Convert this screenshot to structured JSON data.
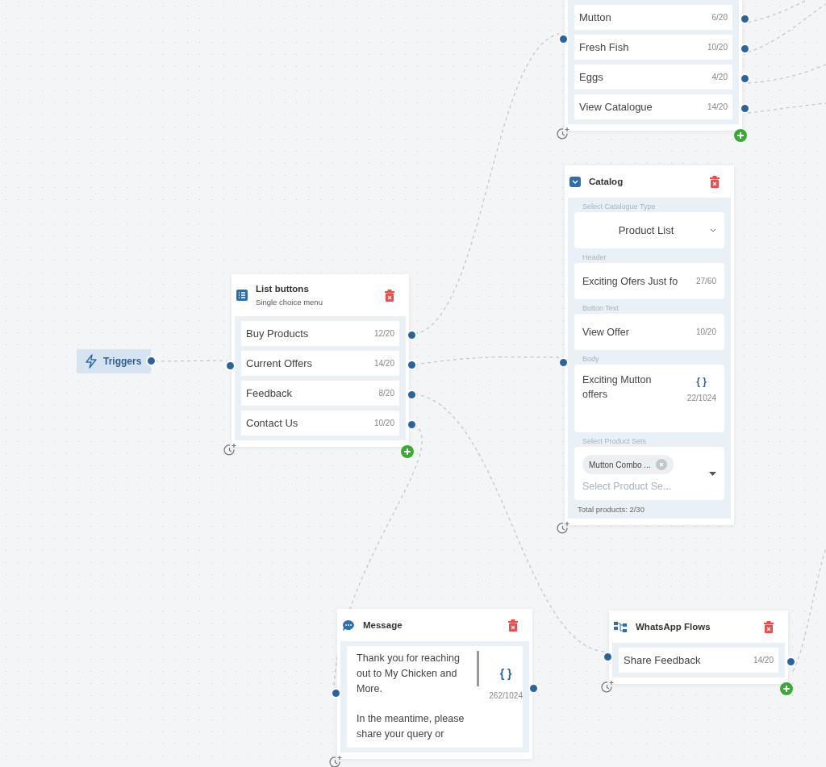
{
  "trigger": {
    "label": "Triggers"
  },
  "nodes": [
    {
      "kind": "buttons",
      "items": [
        {
          "label": "Mutton",
          "count": "6/20"
        },
        {
          "label": "Fresh Fish",
          "count": "10/20"
        },
        {
          "label": "Eggs",
          "count": "4/20"
        },
        {
          "label": "View Catalogue",
          "count": "14/20"
        }
      ]
    },
    {
      "kind": "catalog",
      "title": "Catalog",
      "fields": [
        {
          "kind": "select",
          "label": "Select Catalogue Type",
          "value": "Product List"
        },
        {
          "kind": "text",
          "label": "Header",
          "value": "Exciting Ofers Just fo",
          "count": "27/60"
        },
        {
          "kind": "text",
          "label": "Button Text",
          "value": "View Offer",
          "count": "10/20"
        },
        {
          "kind": "textarea",
          "label": "Body",
          "value": "Exciting Mutton offers",
          "variables": "{ }",
          "count": "22/1024"
        },
        {
          "kind": "multiselect",
          "label": "Select Product Sets",
          "chip": "Mutton Combo ...",
          "placeholder": "Select Product Se..."
        }
      ],
      "footer": "Total products: 2/30"
    },
    {
      "kind": "buttons",
      "title": "List buttons",
      "subtitle": "Single choice menu",
      "items": [
        {
          "label": "Buy Products",
          "count": "12/20"
        },
        {
          "label": "Current Offers",
          "count": "14/20"
        },
        {
          "label": "Feedback",
          "count": "8/20"
        },
        {
          "label": "Contact Us",
          "count": "10/20"
        }
      ]
    },
    {
      "kind": "message",
      "title": "Message",
      "paragraphs": [
        "Thank you for reaching out to My Chicken and More.",
        "In the meantime, please share your query or"
      ],
      "variables": "{ }",
      "count": "262/1024"
    },
    {
      "kind": "buttons",
      "title": "WhatsApp Flows",
      "items": [
        {
          "label": "Share Feedback",
          "count": "14/20"
        }
      ]
    }
  ]
}
